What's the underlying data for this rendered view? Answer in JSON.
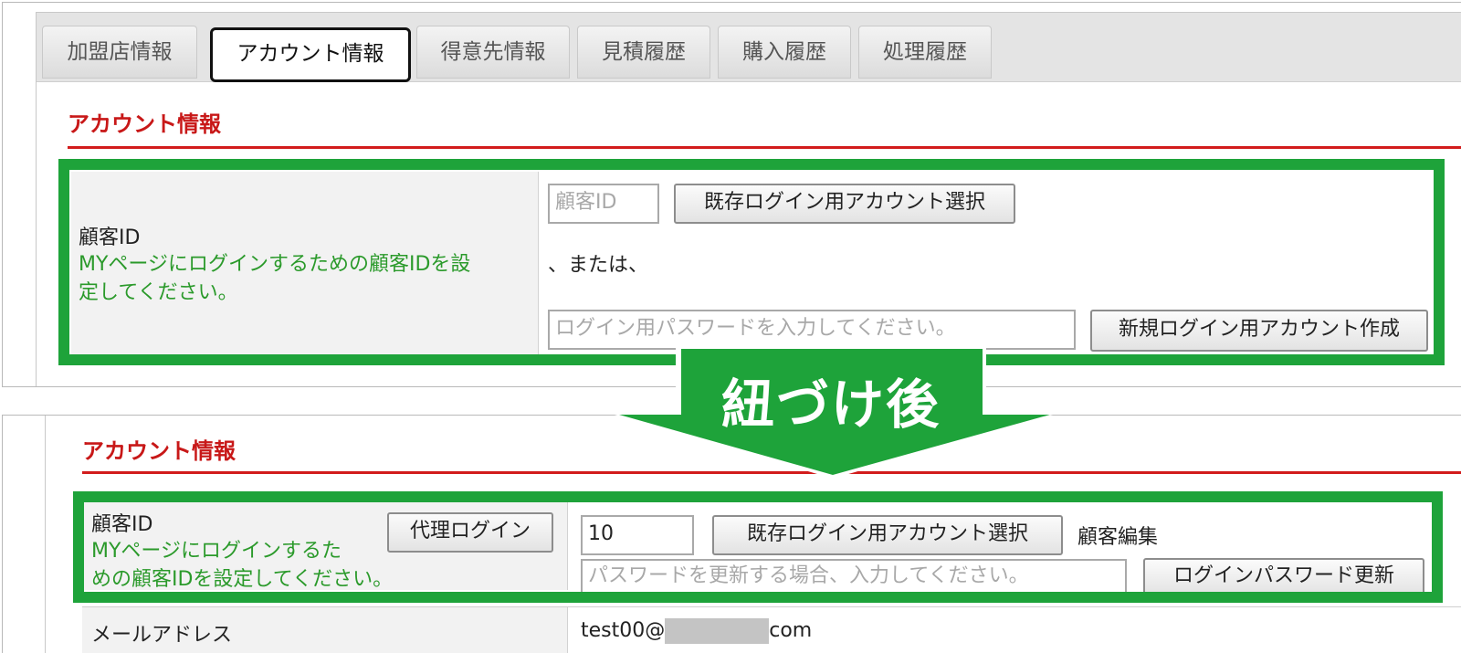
{
  "tabs": [
    {
      "label": "加盟店情報",
      "active": false
    },
    {
      "label": "アカウント情報",
      "active": true
    },
    {
      "label": "得意先情報",
      "active": false
    },
    {
      "label": "見積履歴",
      "active": false
    },
    {
      "label": "購入履歴",
      "active": false
    },
    {
      "label": "処理履歴",
      "active": false
    }
  ],
  "before": {
    "section_title": "アカウント情報",
    "label_main": "顧客ID",
    "label_help_line1": "MYページにログインするための顧客IDを設",
    "label_help_line2": "定してください。",
    "customer_id_placeholder": "顧客ID",
    "select_existing_button": "既存ログイン用アカウント選択",
    "or_text": "、または、",
    "password_placeholder": "ログイン用パスワードを入力してください。",
    "create_new_button": "新規ログイン用アカウント作成"
  },
  "arrow_label": "紐づけ後",
  "after": {
    "section_title": "アカウント情報",
    "label_main": "顧客ID",
    "proxy_login_button": "代理ログイン",
    "label_help_line1": "MYページにログインするた",
    "label_help_line2": "めの顧客IDを設定してください。",
    "customer_id_value": "10",
    "select_existing_button": "既存ログイン用アカウント選択",
    "edit_customer_link": "顧客編集",
    "password_placeholder": "パスワードを更新する場合、入力してください。",
    "update_password_button": "ログインパスワード更新",
    "email_label": "メールアドレス",
    "email_prefix": "test00@",
    "email_suffix": "com"
  },
  "colors": {
    "accent_red": "#d21c1c",
    "highlight_green": "#1ea33a",
    "help_text_green": "#2b9a2b"
  }
}
